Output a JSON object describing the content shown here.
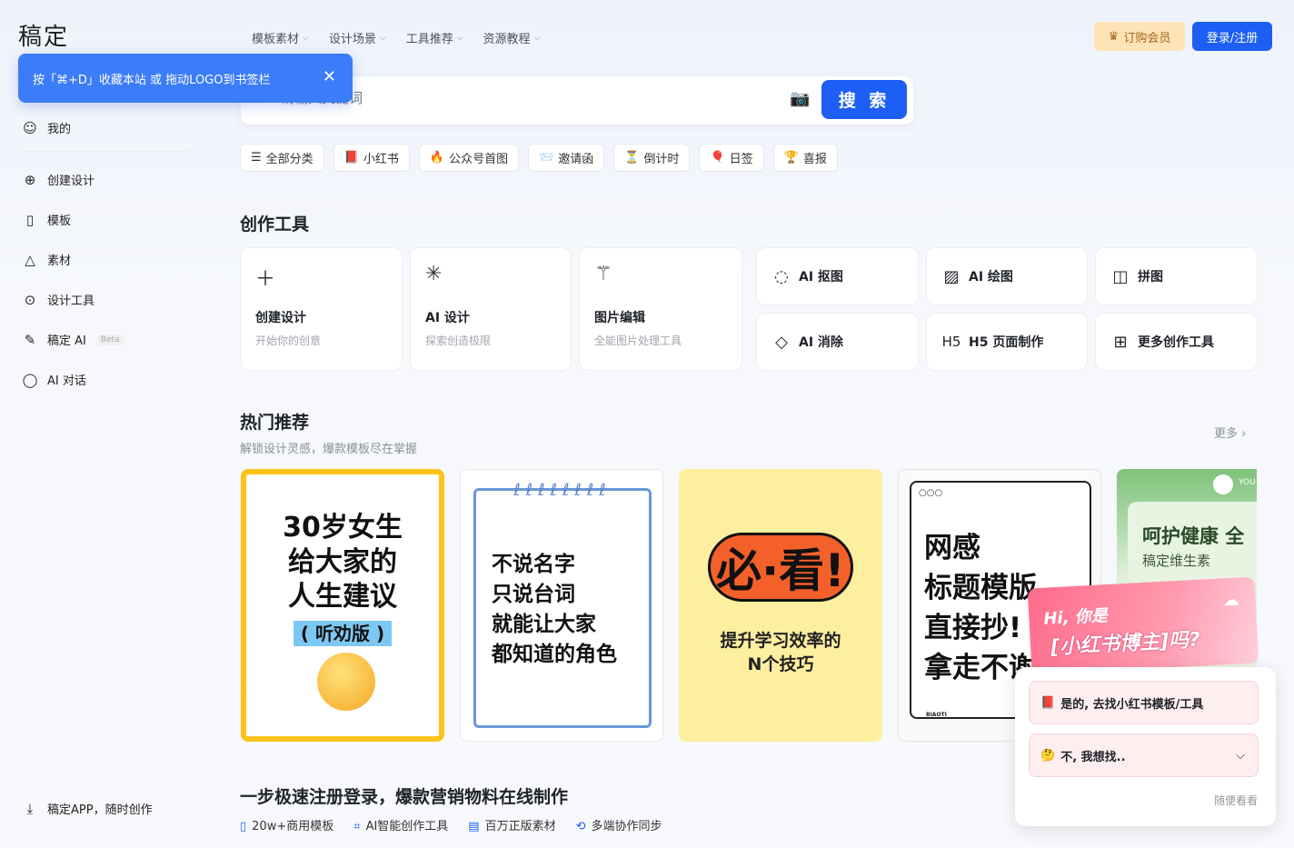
{
  "app": {
    "logo": "稿定"
  },
  "topnav": [
    {
      "label": "模板素材"
    },
    {
      "label": "设计场景"
    },
    {
      "label": "工具推荐"
    },
    {
      "label": "资源教程"
    }
  ],
  "header": {
    "vip_label": "订购会员",
    "login_label": "登录/注册"
  },
  "tip": {
    "text": "按「⌘+D」收藏本站 或 拖动LOGO到书签栏"
  },
  "search": {
    "placeholder": "请输入关键词",
    "button": "搜 索"
  },
  "chips": [
    {
      "icon": "☰",
      "label": "全部分类"
    },
    {
      "icon": "📕",
      "label": "小红书"
    },
    {
      "icon": "🔥",
      "label": "公众号首图"
    },
    {
      "icon": "📨",
      "label": "邀请函"
    },
    {
      "icon": "⏳",
      "label": "倒计时"
    },
    {
      "icon": "🎈",
      "label": "日签"
    },
    {
      "icon": "🏆",
      "label": "喜报"
    }
  ],
  "sidebar": {
    "items": [
      {
        "label": "我的"
      },
      {
        "label": "创建设计"
      },
      {
        "label": "模板"
      },
      {
        "label": "素材"
      },
      {
        "label": "设计工具"
      },
      {
        "label": "稿定 AI",
        "badge": "Beta"
      },
      {
        "label": "AI 对话"
      }
    ],
    "app_label": "稿定APP，随时创作"
  },
  "tools": {
    "title": "创作工具",
    "big": [
      {
        "title": "创建设计",
        "desc": "开始你的创意",
        "icon": "plus-icon"
      },
      {
        "title": "AI 设计",
        "desc": "探索创造极限",
        "icon": "sparkle-icon"
      },
      {
        "title": "图片编辑",
        "desc": "全能图片处理工具",
        "icon": "magic-wand-icon"
      }
    ],
    "small": [
      {
        "title": "AI 抠图",
        "icon": "cutout-icon"
      },
      {
        "title": "AI 绘图",
        "icon": "image-ai-icon"
      },
      {
        "title": "拼图",
        "icon": "collage-icon"
      },
      {
        "title": "AI 消除",
        "icon": "eraser-icon"
      },
      {
        "title": "H5 页面制作",
        "icon": "h5-icon"
      },
      {
        "title": "更多创作工具",
        "icon": "grid-icon"
      }
    ]
  },
  "hot": {
    "title": "热门推荐",
    "subtitle": "解锁设计灵感，爆款模板尽在掌握",
    "more": "更多",
    "templates": [
      {
        "lines": [
          "30岁女生",
          "给大家的",
          "人生建议",
          "( 听劝版 )"
        ]
      },
      {
        "lines": [
          "不说名字",
          "只说台词",
          "就能让大家",
          "都知道的角色"
        ]
      },
      {
        "lines": [
          "必·看!",
          "提升学习效率的",
          "N个技巧"
        ]
      },
      {
        "lines": [
          "网感",
          "标题模版",
          "直接抄!",
          "拿走不谢"
        ],
        "footer": "BIAOTI"
      },
      {
        "lines": [
          "呵护健康 全",
          "稿定维生素"
        ],
        "badge": "YOU"
      }
    ]
  },
  "bottom": {
    "title": "一步极速注册登录，爆款营销物料在线制作",
    "features": [
      "20w+商用模板",
      "AI智能创作工具",
      "百万正版素材",
      "多端协作同步"
    ]
  },
  "popup": {
    "banner_line1": "Hi, 你是",
    "banner_line2": "[小红书博主]吗?",
    "option_yes": "是的, 去找小红书模板/工具",
    "option_no": "不, 我想找..",
    "skip": "随便看看"
  }
}
